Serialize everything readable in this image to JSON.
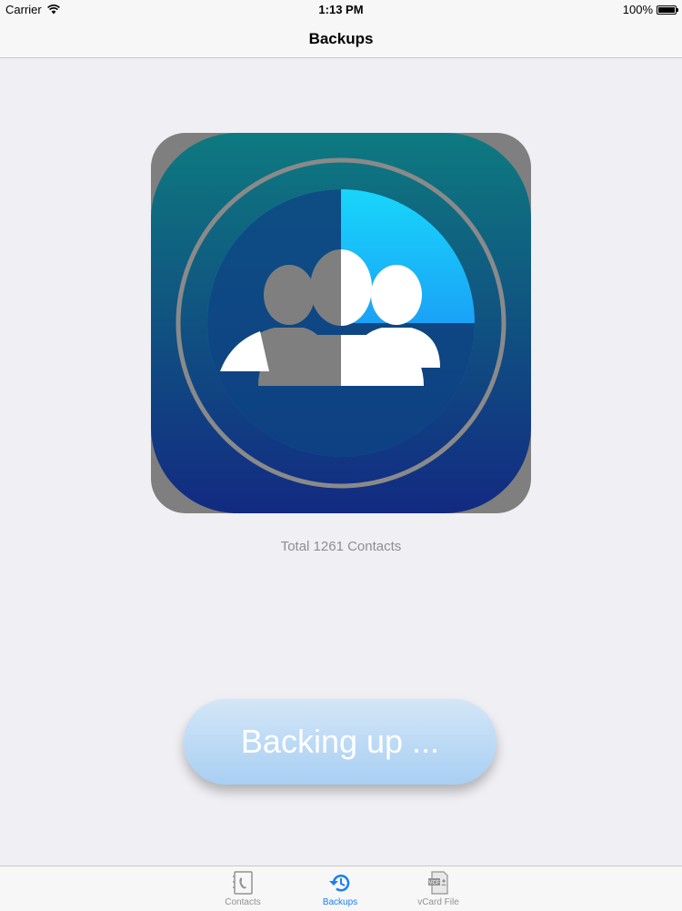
{
  "status_bar": {
    "carrier": "Carrier",
    "time": "1:13 PM",
    "battery": "100%"
  },
  "nav": {
    "title": "Backups"
  },
  "main": {
    "total_contacts": "Total 1261 Contacts",
    "backup_button_label": "Backing up ..."
  },
  "tabs": [
    {
      "label": "Contacts",
      "icon": "contacts-book-icon",
      "active": false
    },
    {
      "label": "Backups",
      "icon": "history-icon",
      "active": true
    },
    {
      "label": "vCard File",
      "icon": "vcf-file-icon",
      "active": false
    }
  ],
  "colors": {
    "accent": "#1a7ff5",
    "tab_inactive": "#929292",
    "button_top": "#d3e6f7",
    "button_bottom": "#a8cff3",
    "icon_teal": "#0e7a80",
    "icon_navy": "#122a82",
    "icon_grey": "#7f7f7f"
  }
}
